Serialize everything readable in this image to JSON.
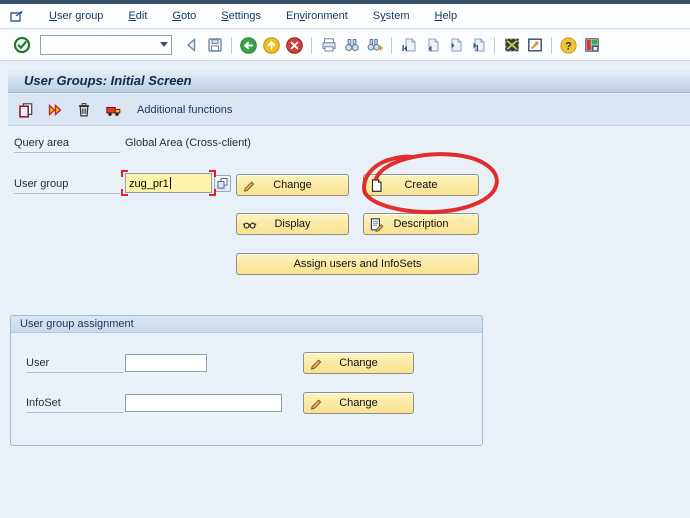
{
  "menu_bar": {
    "items": [
      {
        "label": "User group"
      },
      {
        "label": "Edit"
      },
      {
        "label": "Goto"
      },
      {
        "label": "Settings"
      },
      {
        "label": "Environment"
      },
      {
        "label": "System"
      },
      {
        "label": "Help"
      }
    ]
  },
  "toolbar": {
    "command_field": {
      "value": ""
    },
    "icons": [
      "enter",
      "back-nav",
      "save",
      "back",
      "exit",
      "cancel",
      "print",
      "find",
      "find-next",
      "first-page",
      "previous-page",
      "next-page",
      "last-page",
      "new-session",
      "create-shortcut",
      "help",
      "customize-layout"
    ]
  },
  "title_bar": {
    "title": "User Groups: Initial Screen"
  },
  "app_toolbar": {
    "icons": [
      "copy",
      "execute",
      "delete",
      "transport"
    ],
    "label": "Additional functions"
  },
  "form": {
    "query_area": {
      "label": "Query area",
      "value": "Global Area (Cross-client)"
    },
    "user_group": {
      "label": "User group",
      "value": "zug_pr1"
    },
    "buttons": {
      "change": "Change",
      "create": "Create",
      "display": "Display",
      "description": "Description",
      "assign": "Assign users and InfoSets"
    }
  },
  "assignment": {
    "title": "User group assignment",
    "user": {
      "label": "User",
      "value": ""
    },
    "infoset": {
      "label": "InfoSet",
      "value": ""
    },
    "change_label": "Change"
  },
  "annotation": {
    "type": "hand-drawn-ellipse",
    "color": "#e01d1d",
    "around": "Create button"
  },
  "colors": {
    "top_strip": "#35506b",
    "title_gradient_top": "#eaf2f9",
    "title_gradient_bottom": "#bccfe2",
    "app_toolbar_bg": "#d9e6f2",
    "content_bg": "#e9f0f7",
    "button_bg": "#f9e18f",
    "highlight_input_bg": "#fdf4a9",
    "menu_text": "#17355e"
  }
}
